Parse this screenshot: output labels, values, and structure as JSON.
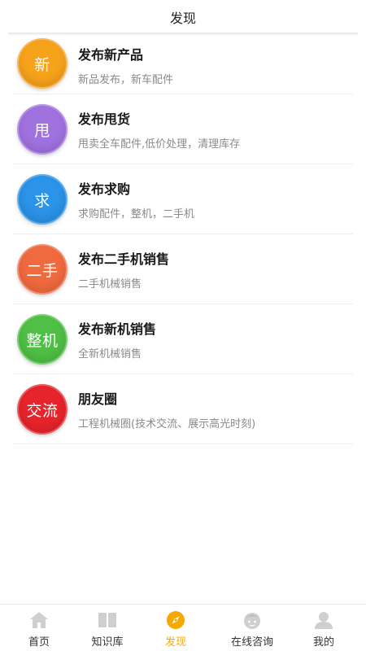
{
  "header": {
    "title": "发现"
  },
  "items": [
    {
      "badge": "新",
      "title": "发布新产品",
      "subtitle": "新品发布，新车配件",
      "color": "#f7a21b"
    },
    {
      "badge": "甩",
      "title": "发布甩货",
      "subtitle": "甩卖全车配件,低价处理，清理库存",
      "color": "#a072e0"
    },
    {
      "badge": "求",
      "title": "发布求购",
      "subtitle": "求购配件，整机，二手机",
      "color": "#2b93e8"
    },
    {
      "badge": "二手",
      "title": "发布二手机销售",
      "subtitle": "二手机械销售",
      "color": "#f06a3f"
    },
    {
      "badge": "整机",
      "title": "发布新机销售",
      "subtitle": "全新机械销售",
      "color": "#4fbf45"
    },
    {
      "badge": "交流",
      "title": "朋友圈",
      "subtitle": "工程机械圈(技术交流、展示高光时刻)",
      "color": "#e6242b"
    }
  ],
  "tabbar": {
    "active_color": "#f5a800",
    "inactive_icon_color": "#cfcfcf",
    "tabs": [
      {
        "label": "首页",
        "icon": "home-icon"
      },
      {
        "label": "知识库",
        "icon": "book-icon"
      },
      {
        "label": "发现",
        "icon": "compass-icon",
        "active": true
      },
      {
        "label": "在线咨询",
        "icon": "consultant-icon"
      },
      {
        "label": "我的",
        "icon": "user-icon"
      }
    ]
  }
}
